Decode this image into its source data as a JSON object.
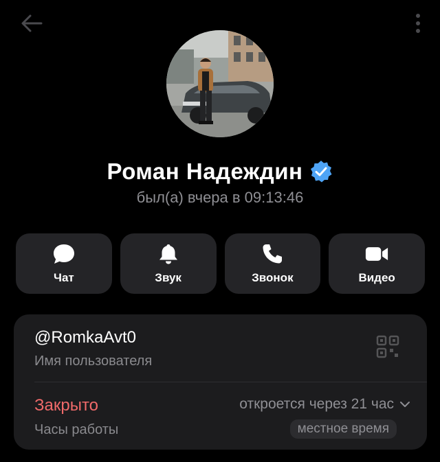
{
  "header": {
    "back_icon": "arrow-left-icon",
    "more_icon": "more-vertical-icon"
  },
  "profile": {
    "name": "Роман Надеждин",
    "verified_icon": "verified-badge-icon",
    "status": "был(а) вчера в 09:13:46",
    "avatar_description_icon": "avatar-photo"
  },
  "actions": [
    {
      "label": "Чат",
      "icon": "chat-bubble-icon"
    },
    {
      "label": "Звук",
      "icon": "bell-icon"
    },
    {
      "label": "Звонок",
      "icon": "phone-icon"
    },
    {
      "label": "Видео",
      "icon": "video-camera-icon"
    }
  ],
  "info": {
    "username": "@RomkaAvt0",
    "username_caption": "Имя пользователя",
    "qr_icon": "qr-code-icon",
    "hours_status": "Закрыто",
    "hours_caption": "Часы работы",
    "opens_in": "откроется через 21 час",
    "local_time": "местное время"
  },
  "colors": {
    "background": "#000000",
    "card": "#1c1c1e",
    "button": "#242427",
    "accent_blue": "#4ea4f6",
    "closed_red": "#f06a6a",
    "muted_text": "#8f8f94"
  }
}
